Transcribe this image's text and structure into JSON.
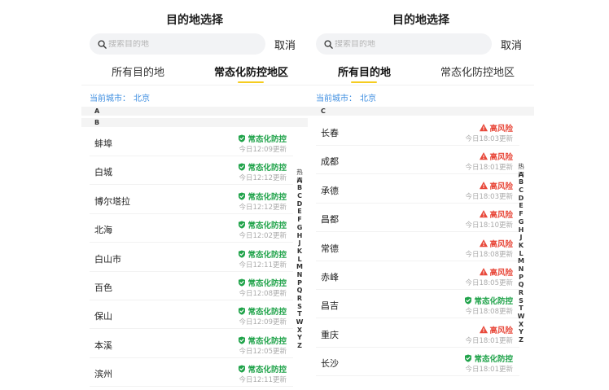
{
  "panels": [
    {
      "title": "目的地选择",
      "search_placeholder": "搜索目的地",
      "cancel_label": "取消",
      "tabs": [
        {
          "label": "所有目的地",
          "active": false
        },
        {
          "label": "常态化防控地区",
          "active": true
        }
      ],
      "current_city_label": "当前城市：",
      "current_city": "北京",
      "sections": [
        {
          "letter": "A",
          "items": []
        },
        {
          "letter": "B",
          "items": [
            {
              "name": "蚌埠",
              "status": "常态化防控",
              "level": "safe",
              "time": "今日12:09更新"
            },
            {
              "name": "白城",
              "status": "常态化防控",
              "level": "safe",
              "time": "今日12:12更新"
            },
            {
              "name": "博尔塔拉",
              "status": "常态化防控",
              "level": "safe",
              "time": "今日12:12更新"
            },
            {
              "name": "北海",
              "status": "常态化防控",
              "level": "safe",
              "time": "今日12:02更新"
            },
            {
              "name": "白山市",
              "status": "常态化防控",
              "level": "safe",
              "time": "今日12:11更新"
            },
            {
              "name": "百色",
              "status": "常态化防控",
              "level": "safe",
              "time": "今日12:08更新"
            },
            {
              "name": "保山",
              "status": "常态化防控",
              "level": "safe",
              "time": "今日12:09更新"
            },
            {
              "name": "本溪",
              "status": "常态化防控",
              "level": "safe",
              "time": "今日12:05更新"
            },
            {
              "name": "滨州",
              "status": "常态化防控",
              "level": "safe",
              "time": "今日12:11更新"
            }
          ]
        }
      ]
    },
    {
      "title": "目的地选择",
      "search_placeholder": "搜索目的地",
      "cancel_label": "取消",
      "tabs": [
        {
          "label": "所有目的地",
          "active": true
        },
        {
          "label": "常态化防控地区",
          "active": false
        }
      ],
      "current_city_label": "当前城市：",
      "current_city": "北京",
      "sections": [
        {
          "letter": "C",
          "items": [
            {
              "name": "长春",
              "status": "高风险",
              "level": "danger",
              "time": "今日18:03更新"
            },
            {
              "name": "成都",
              "status": "高风险",
              "level": "danger",
              "time": "今日18:01更新"
            },
            {
              "name": "承德",
              "status": "高风险",
              "level": "danger",
              "time": "今日18:03更新"
            },
            {
              "name": "昌都",
              "status": "高风险",
              "level": "danger",
              "time": "今日18:10更新"
            },
            {
              "name": "常德",
              "status": "高风险",
              "level": "danger",
              "time": "今日18:08更新"
            },
            {
              "name": "赤峰",
              "status": "高风险",
              "level": "danger",
              "time": "今日18:05更新"
            },
            {
              "name": "昌吉",
              "status": "常态化防控",
              "level": "safe",
              "time": "今日18:08更新"
            },
            {
              "name": "重庆",
              "status": "高风险",
              "level": "danger",
              "time": "今日18:01更新"
            },
            {
              "name": "长沙",
              "status": "常态化防控",
              "level": "safe",
              "time": "今日18:01更新"
            }
          ]
        }
      ]
    }
  ],
  "index_hot_label": "热门",
  "index_letters": [
    "A",
    "B",
    "C",
    "D",
    "E",
    "F",
    "G",
    "H",
    "J",
    "K",
    "L",
    "M",
    "N",
    "P",
    "Q",
    "R",
    "S",
    "T",
    "W",
    "X",
    "Y",
    "Z"
  ],
  "colors": {
    "accent_underline": "#f5cc1f",
    "safe": "#20a34a",
    "danger": "#e8493b",
    "link": "#3c8de0"
  },
  "icons": {
    "search": "search-icon",
    "safe": "shield-check-icon",
    "danger": "warning-triangle-icon"
  }
}
